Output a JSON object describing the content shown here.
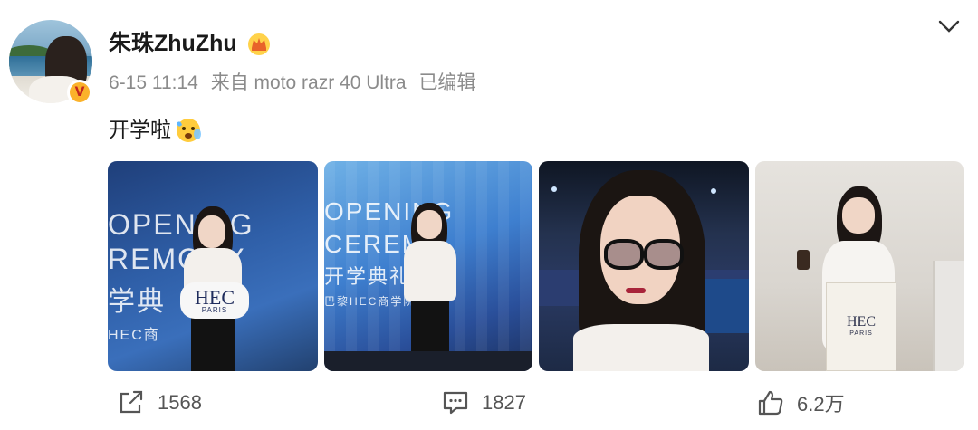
{
  "post": {
    "username": "朱珠ZhuZhu",
    "date": "6-15 11:14",
    "source": "来自 moto razr 40 Ultra",
    "edited": "已编辑",
    "text": "开学啦",
    "emoji": "face-emoji",
    "images": [
      {
        "banner_lines": [
          "OPENING",
          "REMONY",
          "学典"
        ],
        "subtitle": "HEC商",
        "sign": "HEC",
        "sign_sub": "PARIS"
      },
      {
        "banner_lines": [
          "OPENING",
          "CEREMO",
          "开学典礼"
        ],
        "subtitle": "巴黎HEC商学院",
        "sign": "",
        "sign_sub": ""
      },
      {
        "banner_lines": [],
        "subtitle": "",
        "sign": "",
        "sign_sub": ""
      },
      {
        "banner_lines": [],
        "subtitle": "",
        "sign": "HEC",
        "sign_sub": "PARIS"
      }
    ]
  },
  "actions": {
    "repost_count": "1568",
    "comment_count": "1827",
    "like_count": "6.2万"
  },
  "icons": {
    "crown": "crown-badge-icon",
    "verified": "verified-v-icon",
    "chevron": "chevron-down-icon",
    "repost": "repost-icon",
    "comment": "comment-icon",
    "like": "thumbs-up-icon"
  },
  "colors": {
    "verified": "#fbb22a",
    "meta_text": "#8b8b8b",
    "action_text": "#555555"
  }
}
